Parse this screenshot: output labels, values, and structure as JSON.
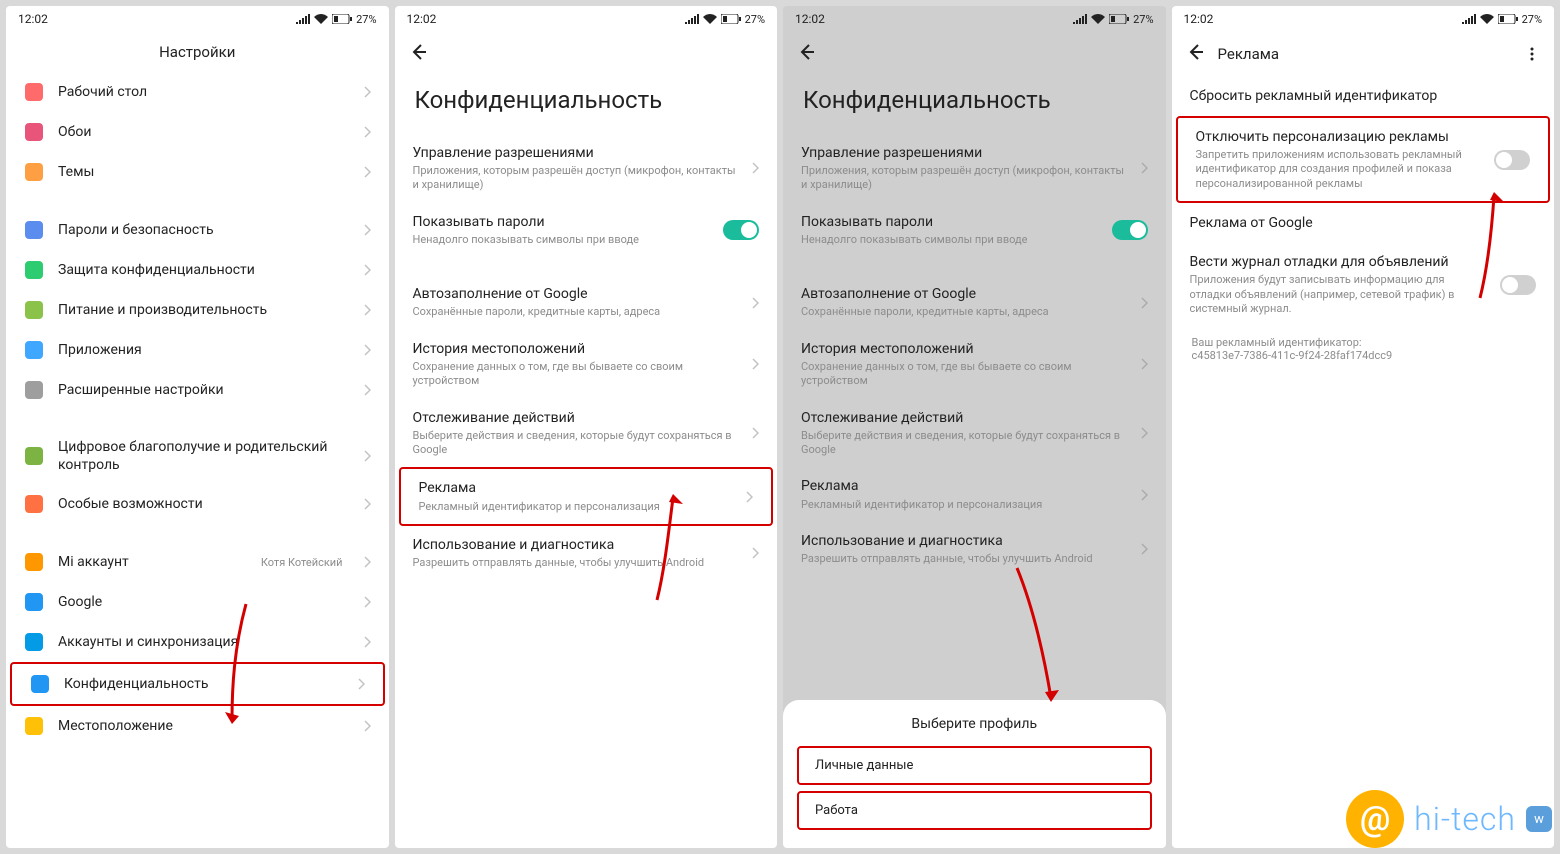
{
  "status": {
    "time": "12:02",
    "battery": "27%"
  },
  "icons": {
    "desktop": "#ff6b6b",
    "wallpaper": "#e8547a",
    "themes": "#ff9f43",
    "security": "#5b8def",
    "privacy": "#2ecc71",
    "battery": "#8bc34a",
    "apps": "#3fa7ff",
    "advanced": "#9e9e9e",
    "wellbeing": "#7cb342",
    "access": "#ff7043",
    "mi": "#ff9800",
    "google": "#2196f3",
    "sync": "#039be5",
    "conf": "#2196f3",
    "loc": "#ffc107"
  },
  "s1": {
    "title": "Настройки",
    "items": [
      {
        "key": "desktop",
        "label": "Рабочий стол"
      },
      {
        "key": "wallpaper",
        "label": "Обои"
      },
      {
        "key": "themes",
        "label": "Темы"
      }
    ],
    "group2": [
      {
        "key": "security",
        "label": "Пароли и безопасность"
      },
      {
        "key": "privacy",
        "label": "Защита конфиденциальности"
      },
      {
        "key": "battery",
        "label": "Питание и производительность"
      },
      {
        "key": "apps",
        "label": "Приложения"
      },
      {
        "key": "advanced",
        "label": "Расширенные настройки"
      }
    ],
    "group3": [
      {
        "key": "wellbeing",
        "label": "Цифровое благополучие и родительский контроль"
      },
      {
        "key": "access",
        "label": "Особые возможности"
      }
    ],
    "group4": [
      {
        "key": "mi",
        "label": "Mi аккаунт",
        "extra": "Котя Котейский"
      },
      {
        "key": "google",
        "label": "Google"
      },
      {
        "key": "sync",
        "label": "Аккаунты и синхронизация"
      },
      {
        "key": "conf",
        "label": "Конфиденциальность",
        "hl": true
      },
      {
        "key": "loc",
        "label": "Местоположение"
      }
    ]
  },
  "s2": {
    "title": "Конфиденциальность",
    "g1": [
      {
        "label": "Управление разрешениями",
        "sub": "Приложения, которым разрешён доступ (микрофон, контакты и хранилище)",
        "chev": true
      },
      {
        "label": "Показывать пароли",
        "sub": "Ненадолго показывать символы при вводе",
        "toggle": "on"
      }
    ],
    "g2": [
      {
        "label": "Автозаполнение от Google",
        "sub": "Сохранённые пароли, кредитные карты, адреса"
      },
      {
        "label": "История местоположений",
        "sub": "Сохранение данных о том, где вы бываете со своим устройством"
      },
      {
        "label": "Отслеживание действий",
        "sub": "Выберите действия и сведения, которые будут сохраняться в Google"
      },
      {
        "label": "Реклама",
        "sub": "Рекламный идентификатор и персонализация",
        "hl": true
      },
      {
        "label": "Использование и диагностика",
        "sub": "Разрешить отправлять данные, чтобы улучшить Android"
      }
    ]
  },
  "s3": {
    "sheet_title": "Выберите профиль",
    "sheet_items": [
      "Личные данные",
      "Работа"
    ]
  },
  "s4": {
    "title": "Реклама",
    "reset": "Сбросить рекламный идентификатор",
    "optout": {
      "label": "Отключить персонализацию рекламы",
      "sub": "Запретить приложениям использовать рекламный идентификатор для создания профилей и показа персонализированной рекламы"
    },
    "google": "Реклама от Google",
    "debug": {
      "label": "Вести журнал отладки для объявлений",
      "sub": "Приложения будут записывать информацию для отладки объявлений (например, сетевой трафик) в системный журнал."
    },
    "id_label": "Ваш рекламный идентификатор:",
    "id_value": "c45813e7-7386-411c-9f24-28faf174dcc9"
  },
  "watermark": "hi-tech"
}
